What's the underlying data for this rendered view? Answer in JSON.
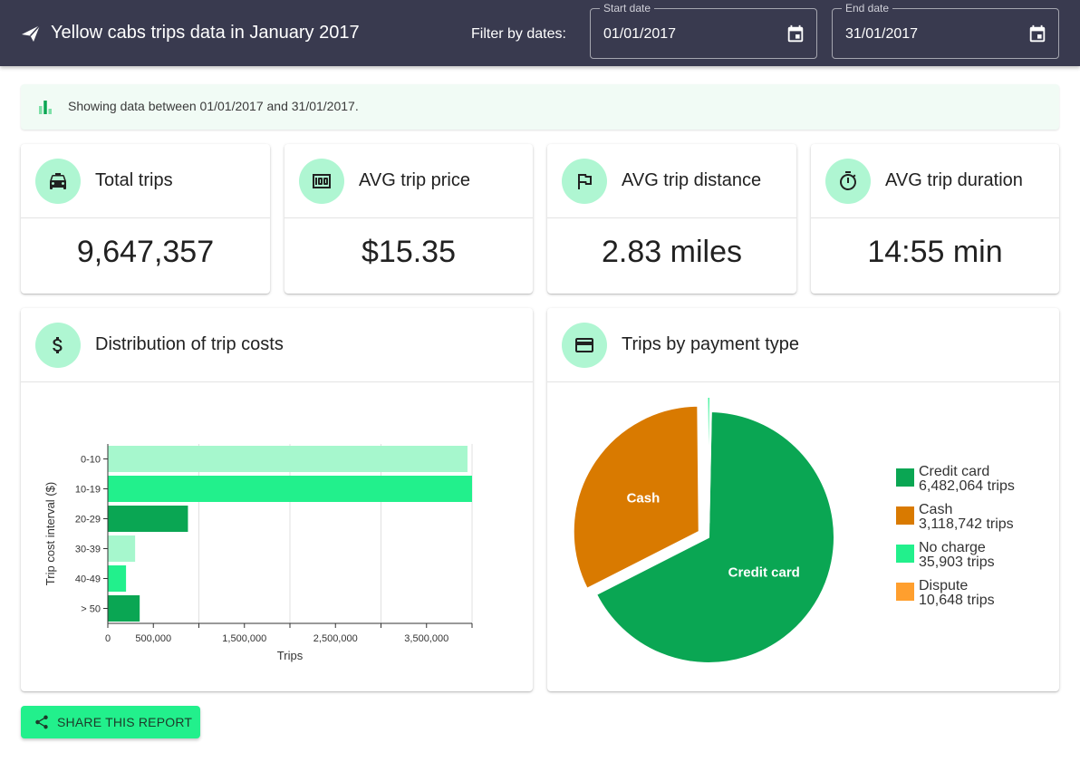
{
  "header": {
    "title": "Yellow cabs trips data in January 2017",
    "filter_label": "Filter by dates:",
    "start_date": {
      "label": "Start date",
      "value": "01/01/2017"
    },
    "end_date": {
      "label": "End date",
      "value": "31/01/2017"
    }
  },
  "info": {
    "text": "Showing data between 01/01/2017 and 31/01/2017."
  },
  "stats": [
    {
      "title": "Total trips",
      "value": "9,647,357",
      "icon": "car-icon"
    },
    {
      "title": "AVG trip price",
      "value": "$15.35",
      "icon": "money-icon"
    },
    {
      "title": "AVG trip distance",
      "value": "2.83 miles",
      "icon": "flag-icon"
    },
    {
      "title": "AVG trip duration",
      "value": "14:55 min",
      "icon": "timer-icon"
    }
  ],
  "cost_card": {
    "title": "Distribution of trip costs",
    "icon": "dollar-icon"
  },
  "payment_card": {
    "title": "Trips by payment type",
    "icon": "credit-card-icon"
  },
  "legend": [
    {
      "name": "Credit card",
      "count": "6,482,064 trips"
    },
    {
      "name": "Cash",
      "count": "3,118,742 trips"
    },
    {
      "name": "No charge",
      "count": "35,903 trips"
    },
    {
      "name": "Dispute",
      "count": "10,648 trips"
    }
  ],
  "share": {
    "label": "SHARE THIS REPORT"
  },
  "colors": {
    "appbar": "#393a4f",
    "accent": "#22f08c",
    "avatar_bg": "#aff6d2",
    "credit_card": "#0aa653",
    "cash": "#d97a00",
    "no_charge": "#22f08c",
    "dispute": "#ff9f2e",
    "bar_light": "#a6f7cd",
    "bar_bright": "#22f08c",
    "bar_dark": "#0aa653"
  },
  "chart_data": [
    {
      "type": "bar",
      "orientation": "horizontal",
      "categories": [
        "0-10",
        "10-19",
        "20-29",
        "30-39",
        "40-49",
        "> 50"
      ],
      "values": [
        3950000,
        4000000,
        880000,
        300000,
        200000,
        350000
      ],
      "bar_colors": [
        "#a6f7cd",
        "#22f08c",
        "#0aa653",
        "#a6f7cd",
        "#22f08c",
        "#0aa653"
      ],
      "xlabel": "Trips",
      "ylabel": "Trip cost interval ($)",
      "xlim": [
        0,
        4000000
      ],
      "x_tick_labels": [
        {
          "value": 0,
          "label": "0"
        },
        {
          "value": 500000,
          "label": "500,000"
        },
        {
          "value": 1500000,
          "label": "1,500,000"
        },
        {
          "value": 2500000,
          "label": "2,500,000"
        },
        {
          "value": 3500000,
          "label": "3,500,000"
        }
      ],
      "grid": true
    },
    {
      "type": "pie",
      "labels": [
        "Credit card",
        "Cash",
        "No charge",
        "Dispute"
      ],
      "values": [
        6482064,
        3118742,
        35903,
        10648
      ],
      "colors": [
        "#0aa653",
        "#d97a00",
        "#22f08c",
        "#ff9f2e"
      ],
      "slice_labels": [
        "Credit card",
        "Cash",
        "",
        ""
      ],
      "legend": "right"
    }
  ]
}
